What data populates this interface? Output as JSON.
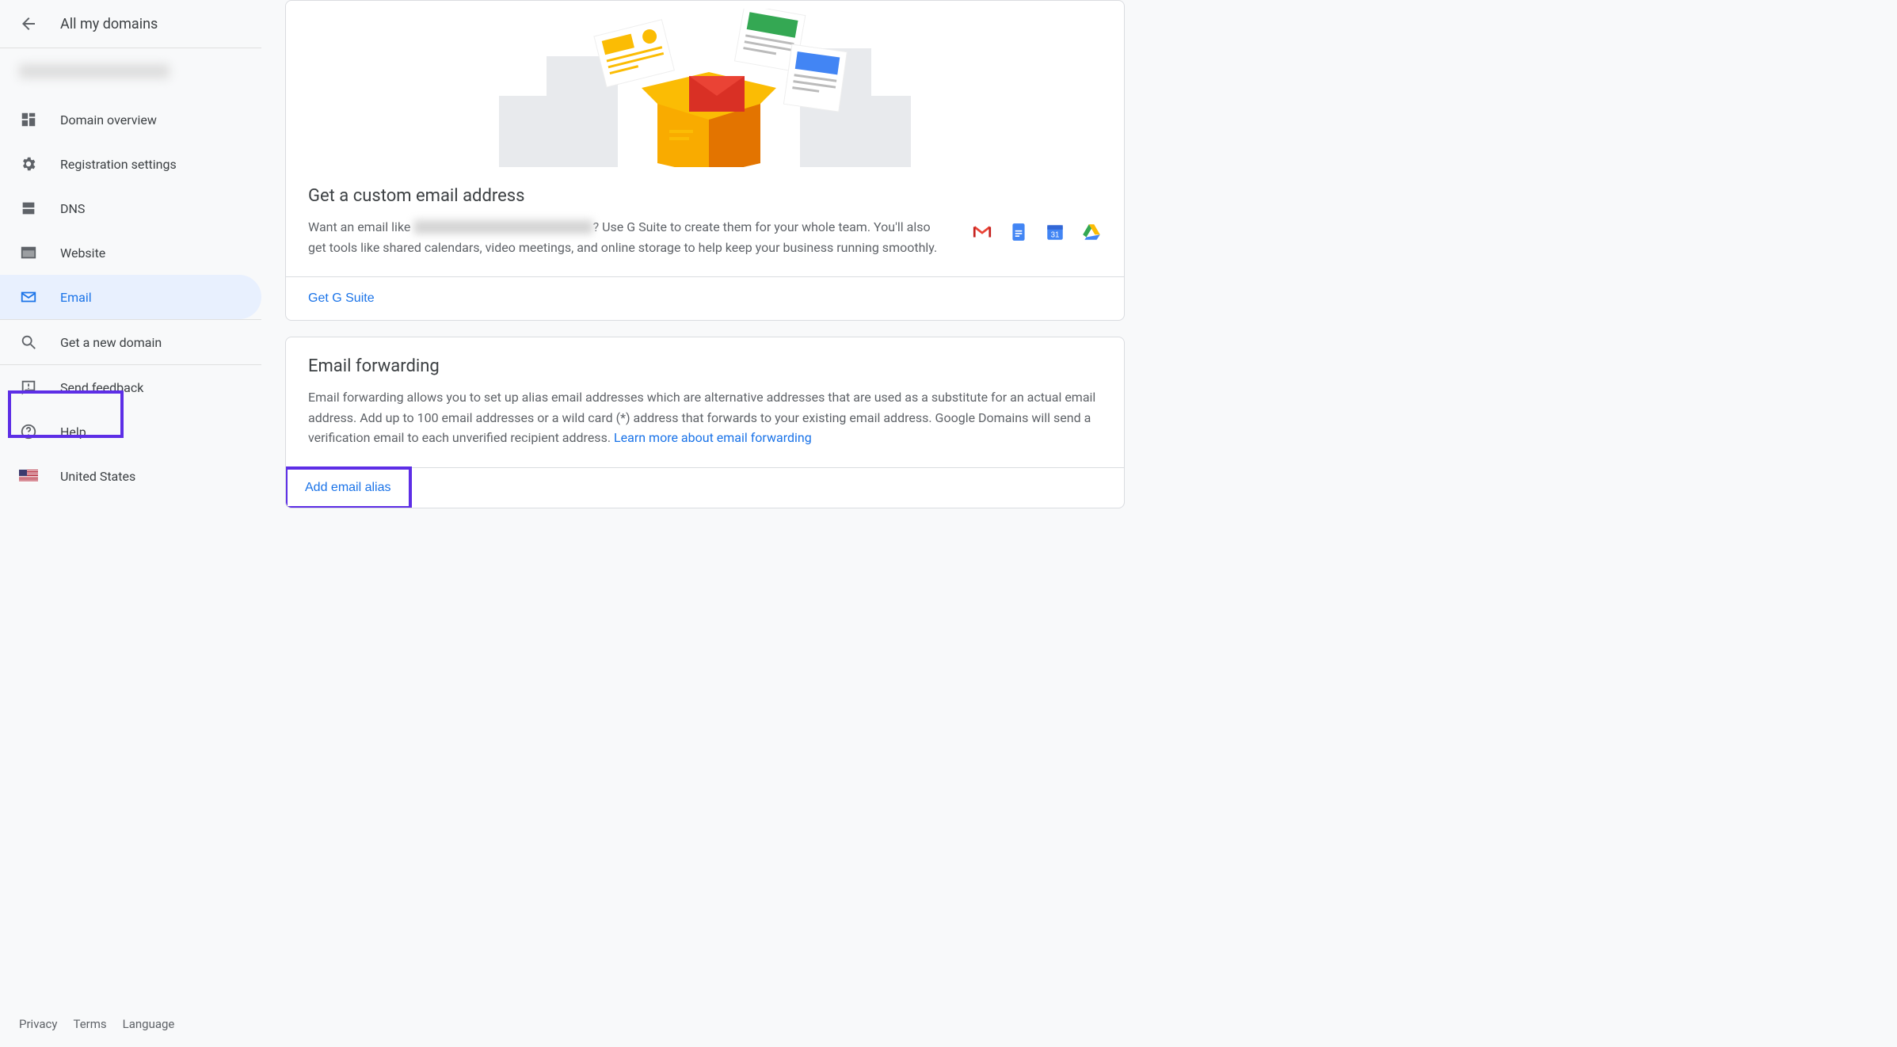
{
  "sidebar": {
    "title": "All my domains",
    "items": [
      {
        "label": "Domain overview"
      },
      {
        "label": "Registration settings"
      },
      {
        "label": "DNS"
      },
      {
        "label": "Website"
      },
      {
        "label": "Email"
      },
      {
        "label": "Get a new domain"
      },
      {
        "label": "Send feedback"
      },
      {
        "label": "Help"
      },
      {
        "label": "United States"
      }
    ],
    "footer": {
      "privacy": "Privacy",
      "terms": "Terms",
      "language": "Language"
    }
  },
  "gsuite": {
    "title": "Get a custom email address",
    "body_prefix": "Want an email like ",
    "body_suffix": "? Use G Suite to create them for your whole team. You'll also get tools like shared calendars, video meetings, and online storage to help keep your business running smoothly.",
    "cta": "Get G Suite"
  },
  "forwarding": {
    "title": "Email forwarding",
    "body": "Email forwarding allows you to set up alias email addresses which are alternative addresses that are used as a substitute for an actual email address. Add up to 100 email addresses or a wild card (*) address that forwards to your existing email address. Google Domains will send a verification email to each unverified recipient address. ",
    "learn_more": "Learn more about email forwarding",
    "add_alias": "Add email alias"
  }
}
